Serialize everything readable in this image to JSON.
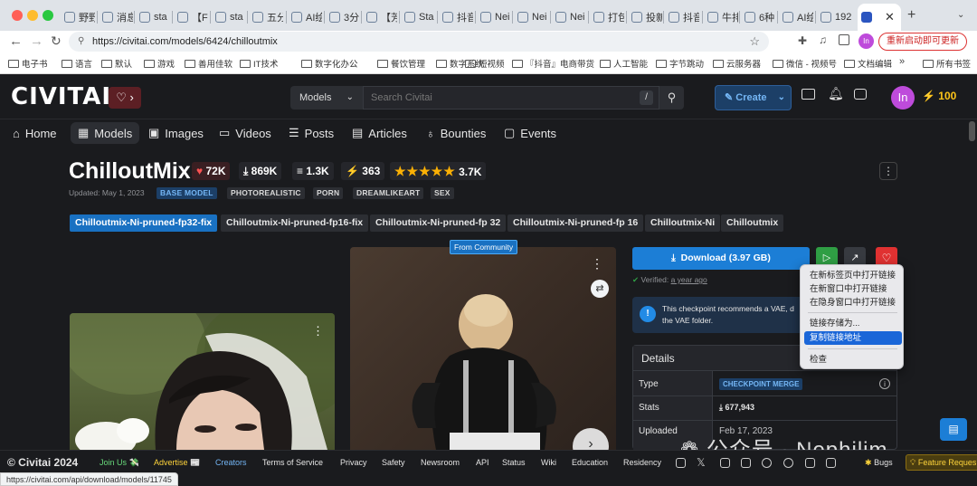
{
  "browser": {
    "tabs": [
      {
        "label": "野野"
      },
      {
        "label": "消息"
      },
      {
        "label": "sta"
      },
      {
        "label": "【F"
      },
      {
        "label": "sta"
      },
      {
        "label": "五分"
      },
      {
        "label": "AI绘"
      },
      {
        "label": "3分"
      },
      {
        "label": "【芳"
      },
      {
        "label": "Sta"
      },
      {
        "label": "抖音"
      },
      {
        "label": "Nei"
      },
      {
        "label": "Nei"
      },
      {
        "label": "Nei"
      },
      {
        "label": "打包"
      },
      {
        "label": "投新"
      },
      {
        "label": "抖音"
      },
      {
        "label": "牛排"
      },
      {
        "label": "6种"
      },
      {
        "label": "AI绘"
      },
      {
        "label": "192"
      }
    ],
    "new_tab_symbol": "+",
    "url": "https://civitai.com/models/6424/chilloutmix",
    "profile_initial": "In",
    "restart_label": "重新启动即可更新",
    "bookmarks": [
      "电子书",
      "语言",
      "默认",
      "游戏",
      "善用佳软",
      "IT技术",
      "数字化办公",
      "餐饮管理",
      "数字系统",
      "短视频",
      "『抖音』电商带货",
      "人工智能",
      "字节跳动",
      "云服务器",
      "微信 - 视频号",
      "文档编辑"
    ],
    "bookmarks_more": "»",
    "all_bookmarks": "所有书签",
    "status_url": "https://civitai.com/api/download/models/11745"
  },
  "site": {
    "logo": "CIVITAI",
    "search_category": "Models",
    "search_placeholder": "Search Civitai",
    "search_shortcut": "/",
    "create_label": "Create",
    "user_initial": "In",
    "buzz": "100",
    "nav": [
      "Home",
      "Models",
      "Images",
      "Videos",
      "Posts",
      "Articles",
      "Bounties",
      "Events"
    ]
  },
  "model": {
    "title": "ChilloutMix",
    "likes": "72K",
    "downloads": "869K",
    "collects": "1.3K",
    "buzz": "363",
    "rating": "3.7K",
    "updated": "Updated: May 1, 2023",
    "tags": [
      "BASE MODEL",
      "PHOTOREALISTIC",
      "PORN",
      "DREAMLIKEART",
      "SEX"
    ],
    "versions": [
      "Chilloutmix-Ni-pruned-fp32-fix",
      "Chilloutmix-Ni-pruned-fp16-fix",
      "Chilloutmix-Ni-pruned-fp 32",
      "Chilloutmix-Ni-pruned-fp 16",
      "Chilloutmix-Ni",
      "Chilloutmix"
    ],
    "community_badge": "From Community",
    "download_label": "Download (3.97 GB)",
    "verified_label": "Verified:",
    "verified_time": "a year ago",
    "vae_notice_1": "This checkpoint recommends a VAE, d",
    "vae_link": "VAE",
    "vae_notice_2": "the VAE folder.",
    "details_title": "Details",
    "details": [
      {
        "label": "Type",
        "value": "CHECKPOINT MERGE"
      },
      {
        "label": "Stats",
        "value": "677,943"
      },
      {
        "label": "Uploaded",
        "value": "Feb 17, 2023"
      }
    ]
  },
  "context_menu": {
    "items": [
      "在新标签页中打开链接",
      "在新窗口中打开链接",
      "在隐身窗口中打开链接",
      "链接存储为...",
      "复制链接地址",
      "检查"
    ],
    "highlighted_index": 4
  },
  "footer": {
    "copyright": "© Civitai 2024",
    "links": [
      "Join Us 💸",
      "Advertise 📰",
      "Creators",
      "Terms of Service",
      "Privacy",
      "Safety",
      "Newsroom",
      "API",
      "Status",
      "Wiki",
      "Education",
      "Residency"
    ],
    "bugs": "Bugs",
    "feature": "Feature Reques"
  },
  "watermark": "公众号 · Nephilim",
  "colors": {
    "accent": "#228be6",
    "dark_bg": "#1a1b1e",
    "card": "#25262b",
    "heart": "#fa5252",
    "star": "#fab005",
    "buzz": "#fcc419",
    "avatar": "#be4bdb"
  }
}
